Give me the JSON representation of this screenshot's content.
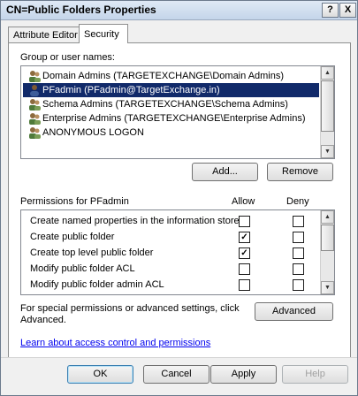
{
  "window": {
    "title": "CN=Public Folders Properties",
    "help_glyph": "?",
    "close_glyph": "X"
  },
  "tabs": [
    {
      "label": "Attribute Editor",
      "active": false
    },
    {
      "label": "Security",
      "active": true
    }
  ],
  "groups": {
    "label": "Group or user names:",
    "items": [
      {
        "label": "Domain Admins (TARGETEXCHANGE\\Domain Admins)",
        "icon": "group-icon",
        "selected": false
      },
      {
        "label": "PFadmin (PFadmin@TargetExchange.in)",
        "icon": "user-icon",
        "selected": true
      },
      {
        "label": "Schema Admins (TARGETEXCHANGE\\Schema Admins)",
        "icon": "group-icon",
        "selected": false
      },
      {
        "label": "Enterprise Admins (TARGETEXCHANGE\\Enterprise Admins)",
        "icon": "group-icon",
        "selected": false
      },
      {
        "label": "ANONYMOUS LOGON",
        "icon": "group-icon",
        "selected": false
      }
    ],
    "add_label": "Add...",
    "remove_label": "Remove"
  },
  "permissions": {
    "label": "Permissions for PFadmin",
    "allow_header": "Allow",
    "deny_header": "Deny",
    "rows": [
      {
        "label": "Create named properties in the information store",
        "allow": false,
        "deny": false
      },
      {
        "label": "Create public folder",
        "allow": true,
        "deny": false
      },
      {
        "label": "Create top level public folder",
        "allow": true,
        "deny": false
      },
      {
        "label": "Modify public folder ACL",
        "allow": false,
        "deny": false
      },
      {
        "label": "Modify public folder admin ACL",
        "allow": false,
        "deny": false
      }
    ]
  },
  "advanced": {
    "text_line1": "For special permissions or advanced settings, click",
    "text_line2": "Advanced.",
    "button_label": "Advanced"
  },
  "learn_link": "Learn about access control and permissions",
  "footer": {
    "ok_label": "OK",
    "cancel_label": "Cancel",
    "apply_label": "Apply",
    "help_label": "Help"
  },
  "colors": {
    "selection": "#112a6a",
    "link": "#0000ee",
    "check": "#000000"
  }
}
